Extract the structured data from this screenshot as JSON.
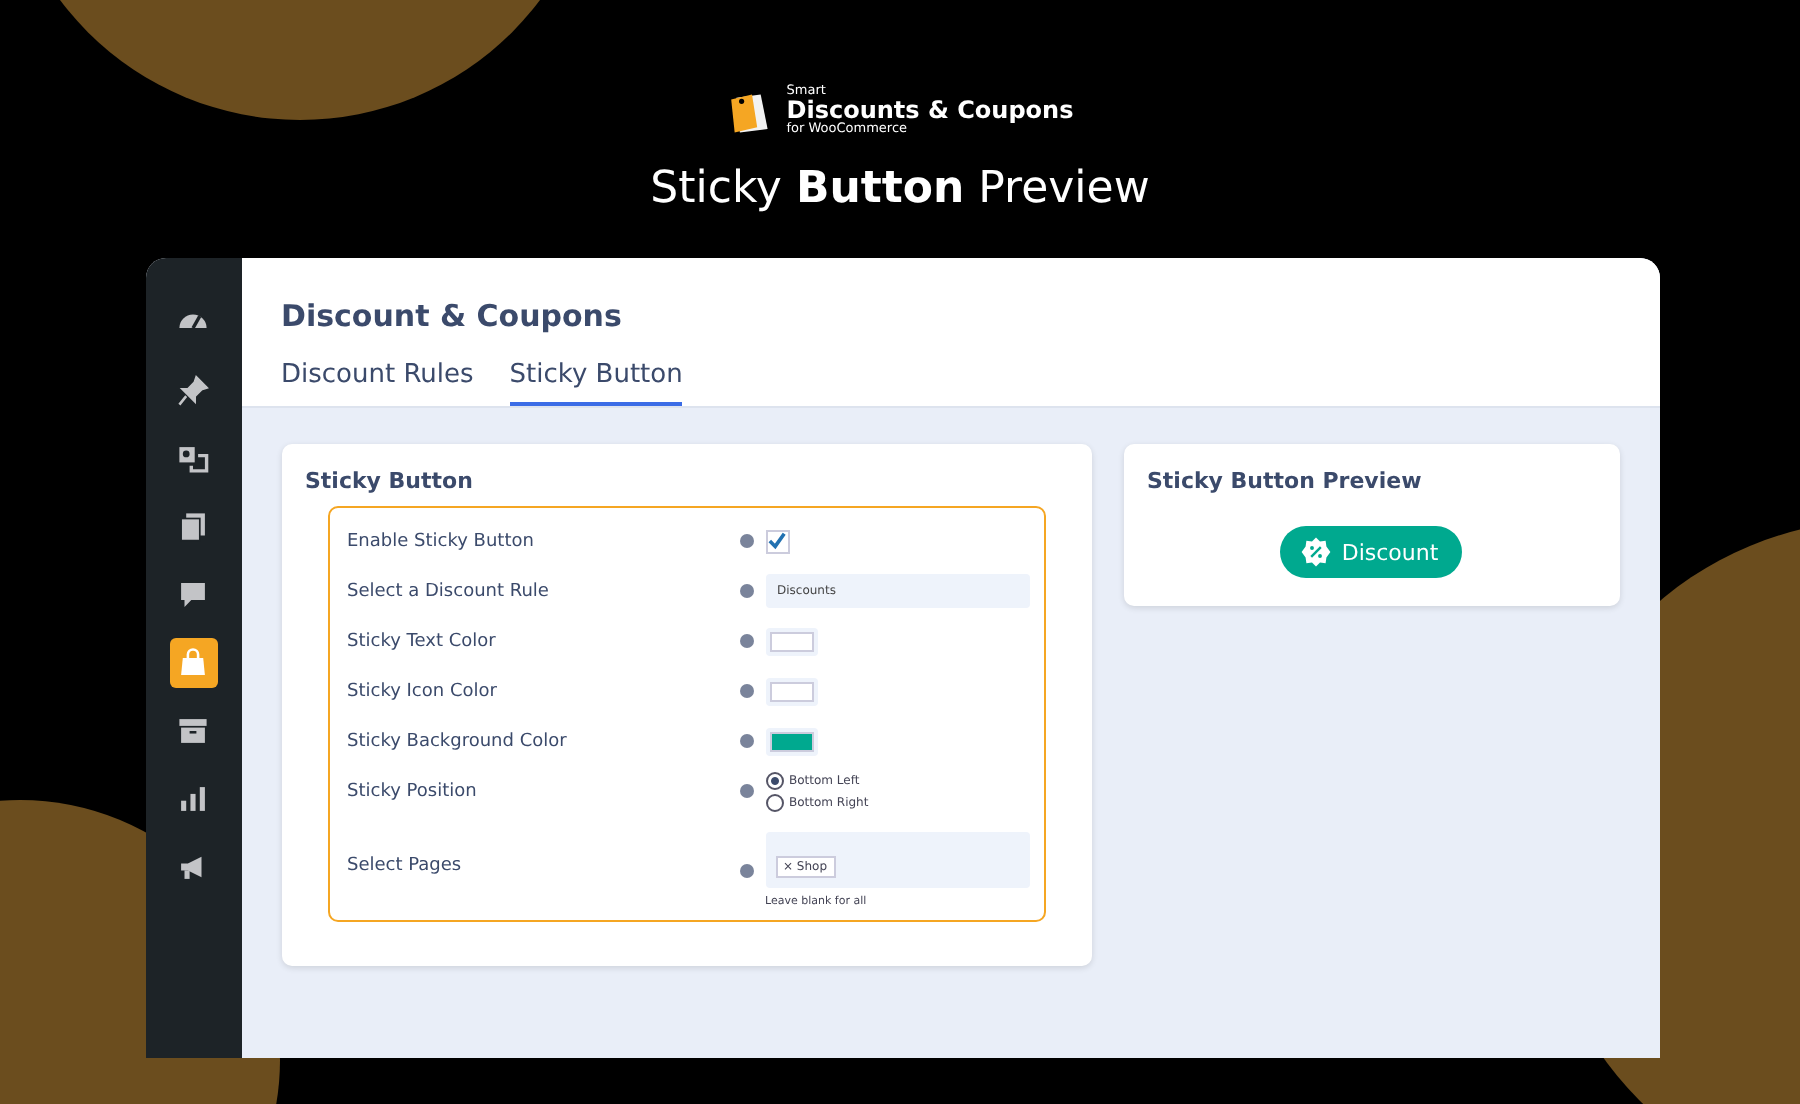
{
  "brand": {
    "small_top": "Smart",
    "name": "Discounts & Coupons",
    "small_bottom": "for WooCommerce"
  },
  "headline": "Sticky **Button** Preview",
  "sidebar": {
    "items": [
      {
        "kind": "gauge",
        "selected": false
      },
      {
        "kind": "pin",
        "selected": false
      },
      {
        "kind": "media",
        "selected": false
      },
      {
        "kind": "pages",
        "selected": false
      },
      {
        "kind": "comment",
        "selected": false
      },
      {
        "kind": "store",
        "selected": true
      },
      {
        "kind": "archive",
        "selected": false
      },
      {
        "kind": "chart",
        "selected": false
      },
      {
        "kind": "megaphone",
        "selected": false
      }
    ]
  },
  "page": {
    "title": "Discount & Coupons",
    "tabs": [
      {
        "label": "Discount Rules",
        "selected": false
      },
      {
        "label": "Sticky Button",
        "selected": true
      }
    ]
  },
  "settings_card": {
    "title": "Sticky Button",
    "rows": [
      {
        "kind": "checkbox",
        "label": "Enable Sticky Button",
        "checked": true
      },
      {
        "kind": "select",
        "label": "Select a Discount Rule",
        "value": "Discounts"
      },
      {
        "kind": "color",
        "label": "Sticky Text Color",
        "color": "#ffffff"
      },
      {
        "kind": "color",
        "label": "Sticky Icon Color",
        "color": "#ffffff"
      },
      {
        "kind": "color",
        "label": "Sticky Background Color",
        "color": "#00a98f"
      },
      {
        "kind": "radio",
        "label": "Sticky Position",
        "options": [
          {
            "label": "Bottom Left",
            "selected": true
          },
          {
            "label": "Bottom Right",
            "selected": false
          }
        ]
      },
      {
        "kind": "tags",
        "label": "Select Pages",
        "tags": [
          "Shop"
        ],
        "tag_remove": "×",
        "hint": "Leave blank for all"
      }
    ]
  },
  "preview_card": {
    "title": "Sticky Button Preview",
    "button": {
      "label": "Discount"
    }
  }
}
